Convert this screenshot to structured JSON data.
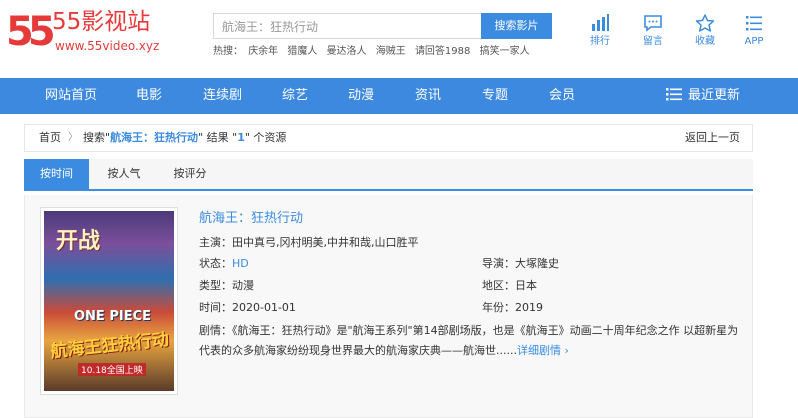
{
  "site": {
    "logo_number": "55",
    "name": "55影视站",
    "url": "www.55video.xyz",
    "brand_color": "#e63a3a",
    "accent_color": "#3b8be0"
  },
  "search": {
    "value": "航海王：狂热行动",
    "button_label": "搜索影片",
    "hot_label": "热搜：",
    "hot_items": [
      "庆余年",
      "猎魔人",
      "曼达洛人",
      "海贼王",
      "请回答1988",
      "搞笑一家人"
    ]
  },
  "top_icons": [
    {
      "label": "排行",
      "icon": "bar-chart-icon"
    },
    {
      "label": "留言",
      "icon": "message-icon"
    },
    {
      "label": "收藏",
      "icon": "star-icon"
    },
    {
      "label": "APP",
      "icon": "menu-list-icon"
    }
  ],
  "nav": {
    "items": [
      "网站首页",
      "电影",
      "连续剧",
      "综艺",
      "动漫",
      "资讯",
      "专题",
      "会员"
    ],
    "latest": "最近更新"
  },
  "breadcrumb": {
    "home": "首页",
    "sep": "〉",
    "prefix": "搜索\"",
    "keyword": "航海王：狂热行动",
    "middle": "\" 结果 \"",
    "count": "1",
    "suffix": "\" 个资源",
    "back": "返回上一页"
  },
  "tabs": [
    "按时间",
    "按人气",
    "按评分"
  ],
  "result": {
    "title": "航海王：狂热行动",
    "cast_label": "主演：",
    "cast": "田中真弓,冈村明美,中井和哉,山口胜平",
    "status_label": "状态：",
    "status": "HD",
    "director_label": "导演：",
    "director": "大塚隆史",
    "type_label": "类型：",
    "type": "动漫",
    "region_label": "地区：",
    "region": "日本",
    "time_label": "时间：",
    "time": "2020-01-01",
    "year_label": "年份：",
    "year": "2019",
    "desc_label": "剧情：",
    "desc": "《航海王：狂热行动》是\"航海王系列\"第14部剧场版，也是《航海王》动画二十周年纪念之作 以超新星为代表的众多航海家纷纷现身世界最大的航海家庆典——航海世......",
    "more": "详细剧情 ›",
    "poster": {
      "headline": "开战",
      "logo": "ONE PIECE",
      "title": "航海王狂热行动",
      "date": "10.18全国上映"
    }
  }
}
